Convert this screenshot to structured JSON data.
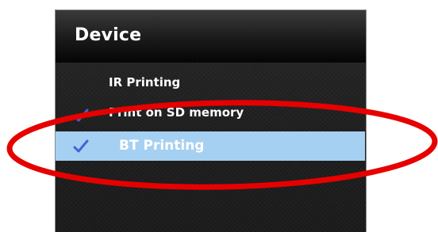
{
  "screen": {
    "title": "Device"
  },
  "menu": {
    "items": [
      {
        "label": "IR Printing",
        "checked": false,
        "selected": false
      },
      {
        "label": "Print on SD memory",
        "checked": true,
        "selected": false
      },
      {
        "label": "BT Printing",
        "checked": true,
        "selected": true
      }
    ]
  },
  "colors": {
    "selection_highlight": "#a6d0f1",
    "checkmark": "#4a5fd8",
    "annotation_ring": "#e60000"
  }
}
